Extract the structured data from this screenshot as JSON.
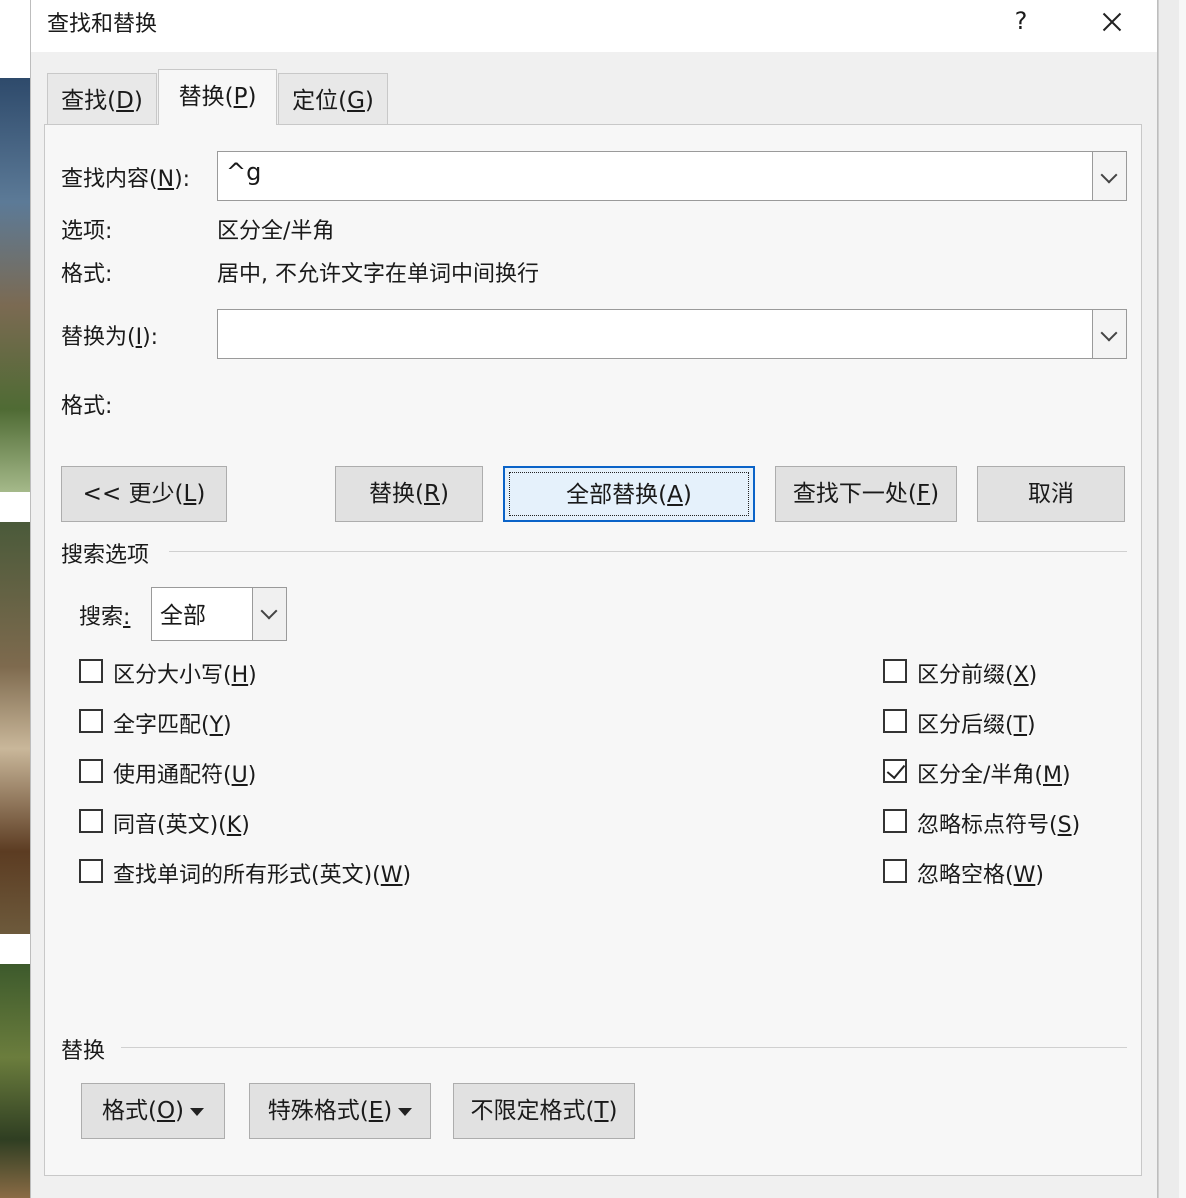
{
  "dialog": {
    "title": "查找和替换",
    "help_label": "?",
    "tabs": [
      {
        "label": "查找(",
        "key": "D",
        "suffix": ")"
      },
      {
        "label": "替换(",
        "key": "P",
        "suffix": ")"
      },
      {
        "label": "定位(",
        "key": "G",
        "suffix": ")"
      }
    ],
    "find": {
      "label": "查找内容(",
      "key": "N",
      "suffix": "):",
      "value": "^g",
      "options_label": "选项:",
      "options_value": "区分全/半角",
      "format_label": "格式:",
      "format_value": "居中, 不允许文字在单词中间换行"
    },
    "replace": {
      "label": "替换为(",
      "key": "I",
      "suffix": "):",
      "value": "",
      "format_label": "格式:"
    },
    "buttons": {
      "less": {
        "label": "<< 更少(",
        "key": "L",
        "suffix": ")"
      },
      "replace": {
        "label": "替换(",
        "key": "R",
        "suffix": ")"
      },
      "replace_all": {
        "label": "全部替换(",
        "key": "A",
        "suffix": ")"
      },
      "find_next": {
        "label": "查找下一处(",
        "key": "F",
        "suffix": ")"
      },
      "cancel": "取消"
    },
    "search_options": {
      "section_title": "搜索选项",
      "search_label": "搜索",
      "search_key": ":",
      "search_value": "全部",
      "left": [
        {
          "label": "区分大小写(",
          "key": "H",
          "suffix": ")",
          "checked": false
        },
        {
          "label": "全字匹配(",
          "key": "Y",
          "suffix": ")",
          "checked": false
        },
        {
          "label": "使用通配符(",
          "key": "U",
          "suffix": ")",
          "checked": false
        },
        {
          "label": "同音(英文)(",
          "key": "K",
          "suffix": ")",
          "checked": false
        },
        {
          "label": "查找单词的所有形式(英文)(",
          "key": "W",
          "suffix": ")",
          "checked": false
        }
      ],
      "right": [
        {
          "label": "区分前缀(",
          "key": "X",
          "suffix": ")",
          "checked": false
        },
        {
          "label": "区分后缀(",
          "key": "T",
          "suffix": ")",
          "checked": false
        },
        {
          "label": "区分全/半角(",
          "key": "M",
          "suffix": ")",
          "checked": true
        },
        {
          "label": "忽略标点符号(",
          "key": "S",
          "suffix": ")",
          "checked": false
        },
        {
          "label": "忽略空格(",
          "key": "W",
          "suffix": ")",
          "checked": false
        }
      ]
    },
    "replace_section": {
      "section_title": "替换",
      "format_btn": {
        "label": "格式(",
        "key": "O",
        "suffix": ")"
      },
      "special_btn": {
        "label": "特殊格式(",
        "key": "E",
        "suffix": ")"
      },
      "no_format_btn": {
        "label": "不限定格式(",
        "key": "T",
        "suffix": ")"
      }
    }
  }
}
